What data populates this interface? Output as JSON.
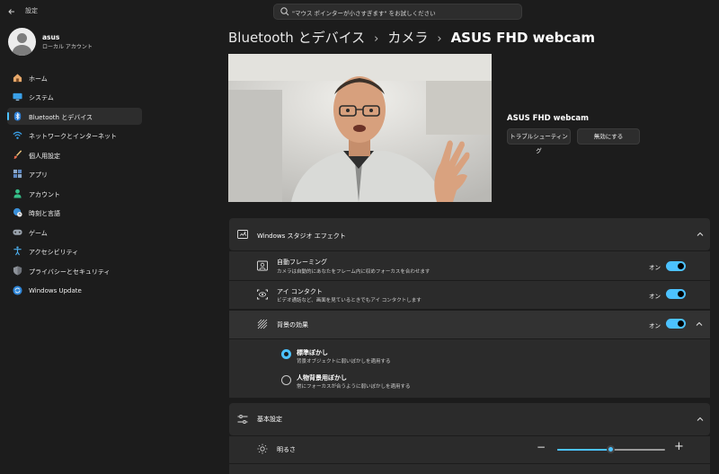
{
  "titlebar": {
    "app_title": "設定",
    "search_placeholder": "\"マウス ポインターが小さすぎます\" をお試しください"
  },
  "profile": {
    "name": "asus",
    "account_type": "ローカル アカウント"
  },
  "sidebar": {
    "items": [
      {
        "label": "ホーム",
        "icon": "home-icon"
      },
      {
        "label": "システム",
        "icon": "monitor-icon"
      },
      {
        "label": "Bluetooth とデバイス",
        "icon": "bluetooth-icon",
        "active": true
      },
      {
        "label": "ネットワークとインターネット",
        "icon": "wifi-icon"
      },
      {
        "label": "個人用設定",
        "icon": "brush-icon"
      },
      {
        "label": "アプリ",
        "icon": "apps-icon"
      },
      {
        "label": "アカウント",
        "icon": "person-icon"
      },
      {
        "label": "時刻と言語",
        "icon": "globe-clock-icon"
      },
      {
        "label": "ゲーム",
        "icon": "gamepad-icon"
      },
      {
        "label": "アクセシビリティ",
        "icon": "accessibility-icon"
      },
      {
        "label": "プライバシーとセキュリティ",
        "icon": "shield-icon"
      },
      {
        "label": "Windows Update",
        "icon": "update-icon"
      }
    ]
  },
  "breadcrumb": {
    "level1": "Bluetooth とデバイス",
    "level2": "カメラ",
    "current": "ASUS FHD webcam",
    "separator": "›"
  },
  "device": {
    "name": "ASUS FHD webcam",
    "troubleshoot_label": "トラブルシューティング",
    "disable_label": "無効にする"
  },
  "studio_effects": {
    "title": "Windows スタジオ エフェクト",
    "auto_framing": {
      "title": "自動フレーミング",
      "description": "カメラは自動的にあなたをフレーム内に収めフォーカスを合わせます",
      "state_label": "オン",
      "on": true
    },
    "eye_contact": {
      "title": "アイ コンタクト",
      "description": "ビデオ通話など、画面を見ているときでもアイ コンタクトします",
      "state_label": "オン",
      "on": true
    },
    "background_effects": {
      "title": "背景の効果",
      "state_label": "オン",
      "on": true,
      "options": [
        {
          "title": "標準ぼかし",
          "description": "背景オブジェクトに弱いぼかしを適用する",
          "selected": true
        },
        {
          "title": "人物背景用ぼかし",
          "description": "常にフォーカスが合うように弱いぼかしを適用する",
          "selected": false
        }
      ]
    }
  },
  "basic_settings": {
    "title": "基本設定",
    "brightness": {
      "label": "明るさ",
      "value_fraction": 0.5,
      "minus": "−",
      "plus": "+"
    }
  },
  "colors": {
    "accent": "#4cc2ff",
    "background": "#1c1c1c",
    "card": "#2b2b2b"
  }
}
